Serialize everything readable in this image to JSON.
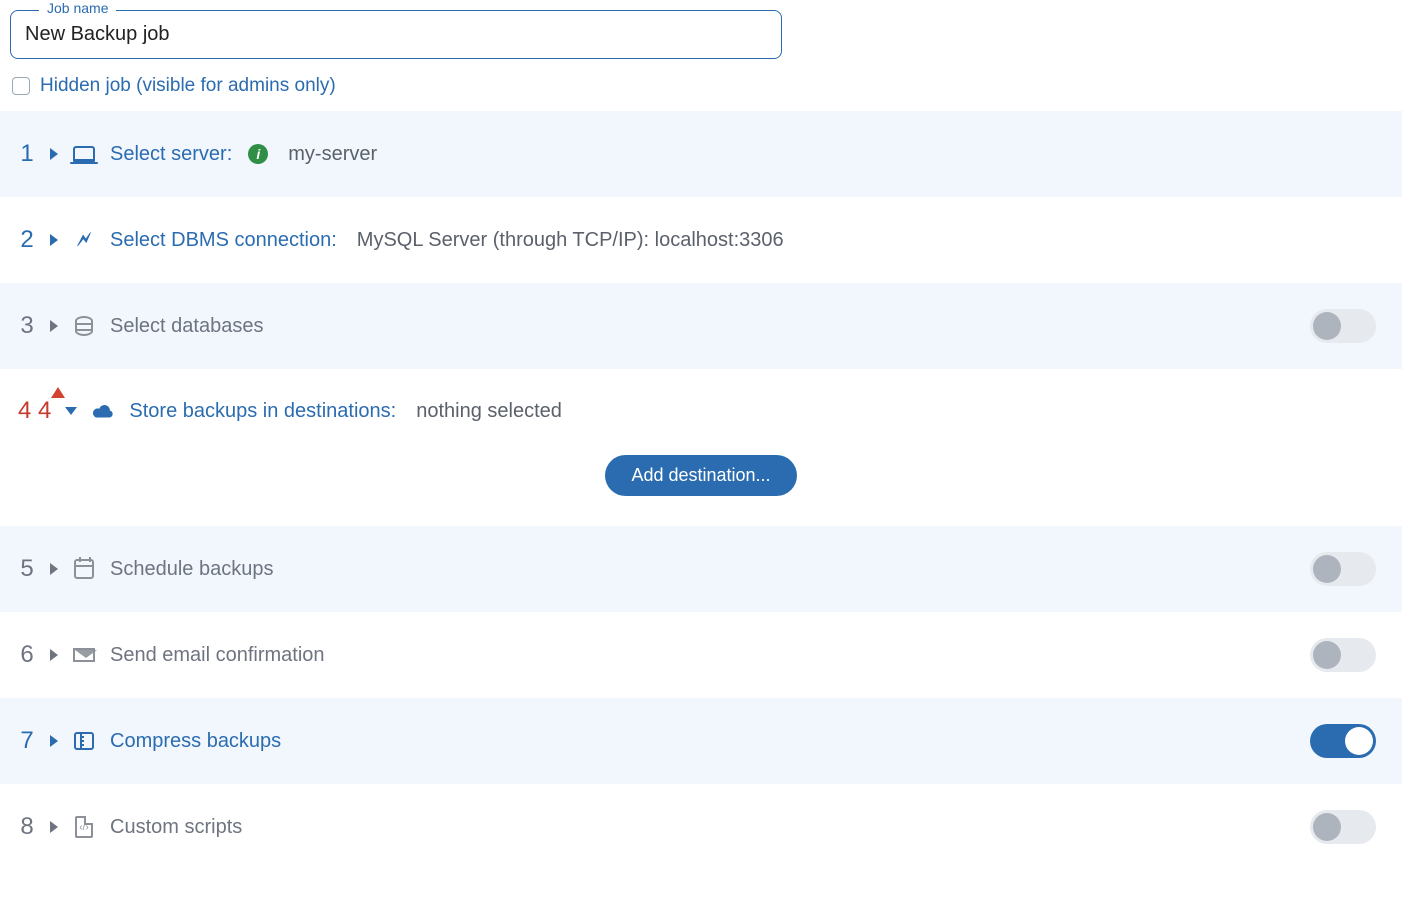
{
  "job_name_field": {
    "legend": "Job name",
    "value": "New Backup job"
  },
  "hidden_job_label": "Hidden job (visible for admins only)",
  "steps": {
    "s1": {
      "num": "1",
      "title": "Select server:",
      "value": "my-server"
    },
    "s2": {
      "num": "2",
      "title": "Select DBMS connection:",
      "value": "MySQL Server (through TCP/IP): localhost:3306"
    },
    "s3": {
      "num": "3",
      "title": "Select databases"
    },
    "s4": {
      "num": "4",
      "title": "Store backups in destinations:",
      "value": "nothing selected",
      "button": "Add destination..."
    },
    "s5": {
      "num": "5",
      "title": "Schedule backups"
    },
    "s6": {
      "num": "6",
      "title": "Send email confirmation"
    },
    "s7": {
      "num": "7",
      "title": "Compress backups"
    },
    "s8": {
      "num": "8",
      "title": "Custom scripts"
    }
  }
}
